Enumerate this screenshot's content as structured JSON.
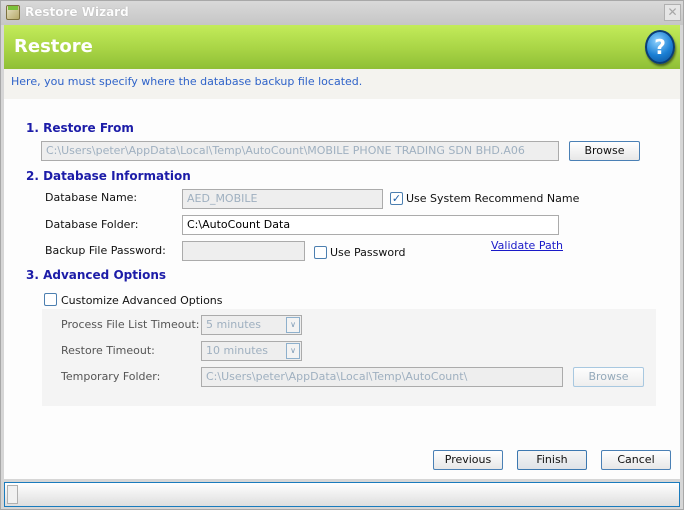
{
  "window": {
    "title": "Restore Wizard",
    "close_icon": "close-icon"
  },
  "banner": {
    "title": "Restore",
    "help_icon": "help-icon"
  },
  "instruction": "Here, you must specify where the database backup file located.",
  "restore_from": {
    "title": "1. Restore From",
    "path": "C:\\Users\\peter\\AppData\\Local\\Temp\\AutoCount\\MOBILE PHONE TRADING SDN BHD.A06",
    "browse_label": "Browse"
  },
  "database_info": {
    "title": "2. Database Information",
    "name_label": "Database Name:",
    "name_value": "AED_MOBILE",
    "use_recommend_label": "Use System Recommend Name",
    "use_recommend_checked": true,
    "folder_label": "Database Folder:",
    "folder_value": "C:\\AutoCount Data",
    "password_label": "Backup File Password:",
    "password_value": "",
    "use_password_label": "Use Password",
    "use_password_checked": false,
    "validate_link": "Validate Path"
  },
  "advanced": {
    "title": "3. Advanced Options",
    "customize_label": "Customize Advanced Options",
    "customize_checked": false,
    "process_timeout_label": "Process File List Timeout:",
    "process_timeout_value": "5 minutes",
    "restore_timeout_label": "Restore Timeout:",
    "restore_timeout_value": "10 minutes",
    "temp_folder_label": "Temporary Folder:",
    "temp_folder_value": "C:\\Users\\peter\\AppData\\Local\\Temp\\AutoCount\\",
    "browse_label": "Browse"
  },
  "footer": {
    "previous_label": "Previous",
    "finish_label": "Finish",
    "cancel_label": "Cancel"
  },
  "progress": {
    "value_percent": 0
  },
  "colors": {
    "banner_green": "#a8d445",
    "section_title": "#1c1ca8",
    "instruction_text": "#2f63c9",
    "status_border": "#1a7bbd"
  }
}
